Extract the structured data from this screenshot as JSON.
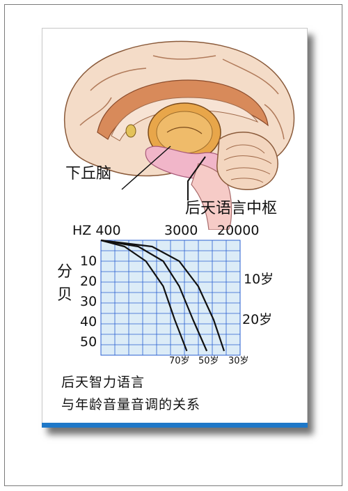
{
  "labels": {
    "inferior_colliculus": "下丘脑",
    "language_center": "后天语言中枢"
  },
  "caption": {
    "line1": "后天智力语言",
    "line2": "与年龄音量音调的关系"
  },
  "colors": {
    "grid": "#2a5fd1",
    "chart_bg": "#dcecf7",
    "curve": "#111111",
    "card_bar": "#1f78c8",
    "brain_outer": "#f4dcc8",
    "brain_inner": "#d88a5a",
    "thalamus": "#e8a64a",
    "cerebellum": "#f3d6bf",
    "pink_region": "#f1b6c9"
  },
  "chart_data": {
    "type": "line",
    "x_ticks": [
      "HZ 400",
      "3000",
      "20000"
    ],
    "y_axis_label": "分贝",
    "y_ticks": [
      10,
      20,
      30,
      40,
      50
    ],
    "ylim": [
      0,
      55
    ],
    "series": [
      {
        "name": "70岁",
        "x": [
          400,
          800,
          1500,
          2500,
          3500,
          5000
        ],
        "y": [
          0,
          3,
          10,
          22,
          38,
          53
        ]
      },
      {
        "name": "50岁",
        "x": [
          400,
          1200,
          2500,
          4000,
          6000,
          9000
        ],
        "y": [
          0,
          3,
          10,
          22,
          38,
          53
        ]
      },
      {
        "name": "30岁",
        "x": [
          400,
          1800,
          4000,
          7000,
          11000,
          15000
        ],
        "y": [
          0,
          3,
          10,
          22,
          38,
          53
        ]
      }
    ],
    "extra_curve_labels": [
      "10岁",
      "20岁"
    ]
  }
}
